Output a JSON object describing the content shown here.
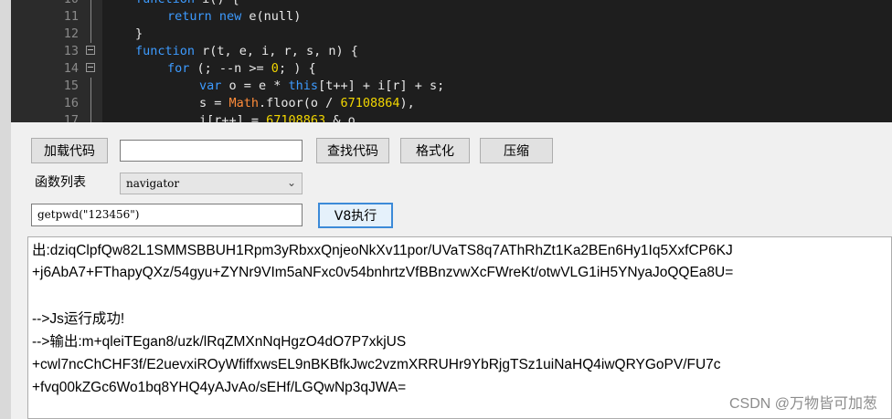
{
  "editor": {
    "lines": [
      {
        "num": "10",
        "fold": false,
        "indent": 1,
        "tokens": [
          {
            "t": "function ",
            "c": "kw"
          },
          {
            "t": "i() {",
            "c": ""
          }
        ]
      },
      {
        "num": "11",
        "fold": false,
        "indent": 2,
        "tokens": [
          {
            "t": "return ",
            "c": "kw"
          },
          {
            "t": "new ",
            "c": "kw"
          },
          {
            "t": "e(null)",
            "c": ""
          }
        ]
      },
      {
        "num": "12",
        "fold": false,
        "indent": 1,
        "tokens": [
          {
            "t": "}",
            "c": ""
          }
        ]
      },
      {
        "num": "13",
        "fold": true,
        "indent": 1,
        "tokens": [
          {
            "t": "function ",
            "c": "kw"
          },
          {
            "t": "r(t, e, i, r, s, n) {",
            "c": ""
          }
        ]
      },
      {
        "num": "14",
        "fold": true,
        "indent": 2,
        "tokens": [
          {
            "t": "for ",
            "c": "kw"
          },
          {
            "t": "(; --n >= ",
            "c": ""
          },
          {
            "t": "0",
            "c": "num"
          },
          {
            "t": "; ) {",
            "c": ""
          }
        ]
      },
      {
        "num": "15",
        "fold": false,
        "indent": 3,
        "tokens": [
          {
            "t": "var ",
            "c": "kw"
          },
          {
            "t": "o = e * ",
            "c": ""
          },
          {
            "t": "this",
            "c": "kw"
          },
          {
            "t": "[t++] + i[r] + s;",
            "c": ""
          }
        ]
      },
      {
        "num": "16",
        "fold": false,
        "indent": 3,
        "tokens": [
          {
            "t": "s = ",
            "c": ""
          },
          {
            "t": "Math",
            "c": "cls"
          },
          {
            "t": ".floor(o / ",
            "c": ""
          },
          {
            "t": "67108864",
            "c": "num"
          },
          {
            "t": "),",
            "c": ""
          }
        ]
      },
      {
        "num": "17",
        "fold": false,
        "indent": 3,
        "tokens": [
          {
            "t": "i[r++] = ",
            "c": ""
          },
          {
            "t": "67108863",
            "c": "num"
          },
          {
            "t": " & o",
            "c": ""
          }
        ]
      }
    ]
  },
  "toolbar": {
    "load_label": "加载代码",
    "search_value": "",
    "find_label": "查找代码",
    "format_label": "格式化",
    "compress_label": "压缩"
  },
  "functions": {
    "label": "函数列表",
    "selected": "navigator"
  },
  "exec": {
    "input_value": "getpwd(\"123456\")",
    "run_label": "V8执行"
  },
  "output": {
    "lines": [
      "出:dziqClpfQw82L1SMMSBBUH1Rpm3yRbxxQnjeoNkXv11por/UVaTS8q7AThRhZt1Ka2BEn6Hy1Iq5XxfCP6KJ",
      "+j6AbA7+FThapyQXz/54gyu+ZYNr9VIm5aNFxc0v54bnhrtzVfBBnzvwXcFWreKt/otwVLG1iH5YNyaJoQQEa8U=",
      "",
      "-->Js运行成功!",
      "-->输出:m+qleiTEgan8/uzk/lRqZMXnNqHgzO4dO7P7xkjUS",
      "+cwl7ncChCHF3f/E2uevxiROyWfiffxwsEL9nBKBfkJwc2vzmXRRUHr9YbRjgTSz1uiNaHQ4iwQRYGoPV/FU7c",
      "+fvq00kZGc6Wo1bq8YHQ4yAJvAo/sEHf/LGQwNp3qJWA="
    ]
  },
  "watermark": "CSDN @万物皆可加葱"
}
